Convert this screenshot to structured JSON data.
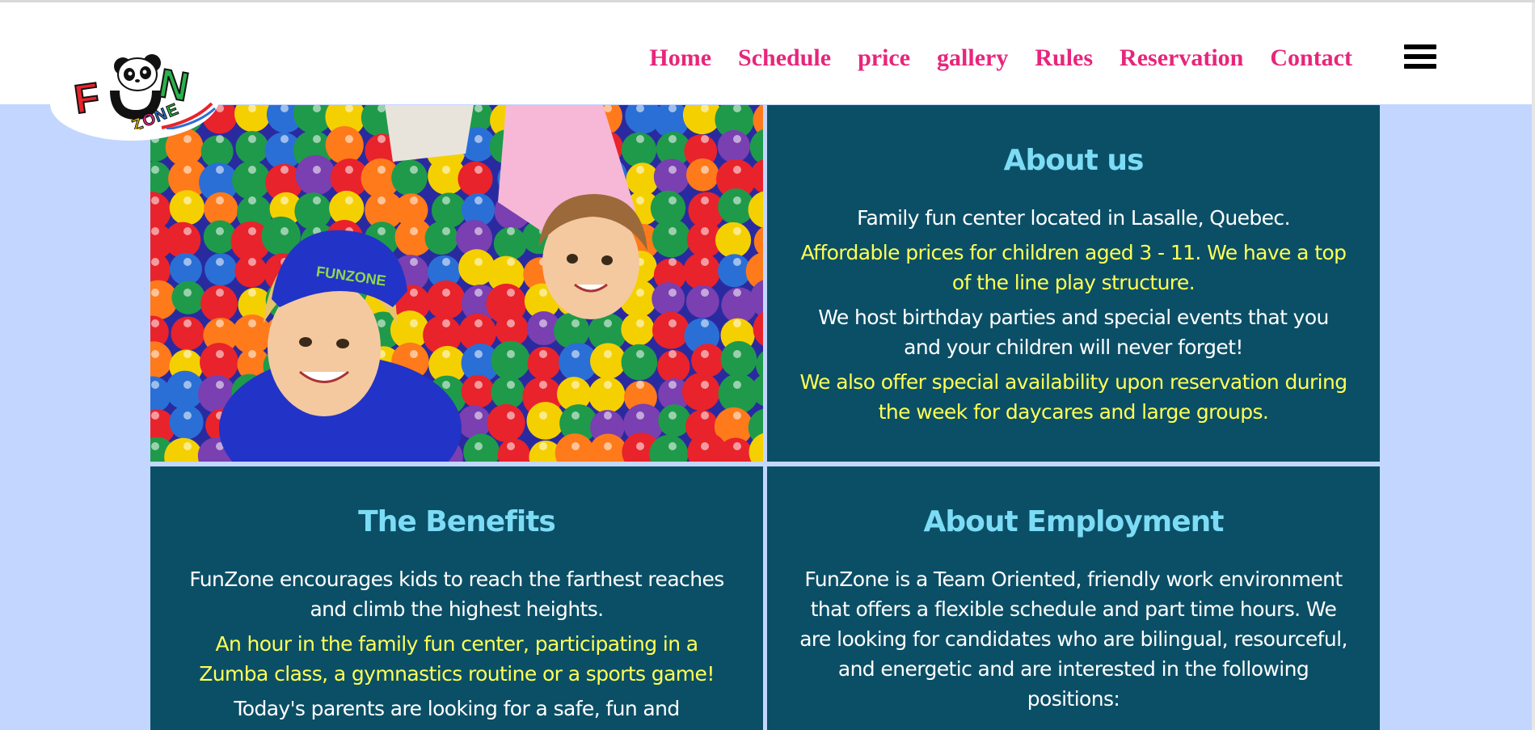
{
  "logo": {
    "alt": "FunZone",
    "word_fun": "FUN",
    "word_zone": "ZONE"
  },
  "nav": {
    "items": [
      "Home",
      "Schedule",
      "price",
      "gallery",
      "Rules",
      "Reservation",
      "Contact"
    ],
    "menu_icon": "hamburger-menu-icon"
  },
  "photo": {
    "description": "children-in-ball-pit",
    "cap_text": "FUNZONE"
  },
  "about": {
    "title": "About us",
    "p1": "Family fun center located in Lasalle, Quebec.",
    "p2": "Affordable prices for children aged 3 - 11. We have a top of the line play structure.",
    "p3": "We host birthday parties and special events that you and your children will never forget!",
    "p4": "We also offer special availability upon reservation during the week for daycares and large groups."
  },
  "benefits": {
    "title": "The Benefits",
    "p1": "FunZone encourages kids to reach the farthest reaches and climb the highest heights.",
    "p2": "An hour in the family fun center, participating in a Zumba class, a gymnastics routine or a sports game!",
    "p3": "Today's parents are looking for a safe, fun and affordable"
  },
  "employment": {
    "title": "About Employment",
    "p1": "FunZone is a Team Oriented, friendly work environment that offers a flexible schedule and part time hours. We are looking for candidates who are bilingual, resourceful, and energetic and are interested in the following positions:"
  },
  "colors": {
    "background": "#c2d6ff",
    "panel": "#0b4f66",
    "heading": "#7ddcf5",
    "highlight": "#ffff55",
    "nav": "#e8257b"
  }
}
